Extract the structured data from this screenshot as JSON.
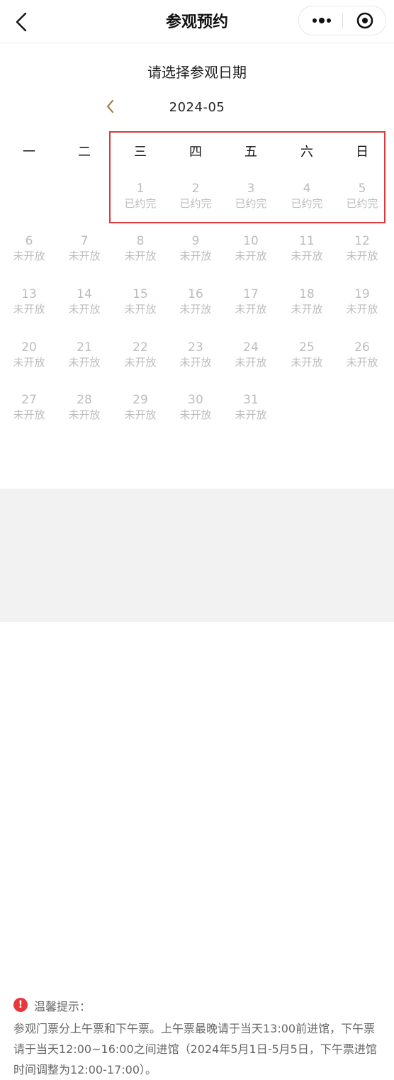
{
  "header": {
    "title": "参观预约"
  },
  "heading": "请选择参观日期",
  "month": "2024-05",
  "weekdays": [
    "一",
    "二",
    "三",
    "四",
    "五",
    "六",
    "日"
  ],
  "days": [
    {
      "num": "1",
      "status": "已约完"
    },
    {
      "num": "2",
      "status": "已约完"
    },
    {
      "num": "3",
      "status": "已约完"
    },
    {
      "num": "4",
      "status": "已约完"
    },
    {
      "num": "5",
      "status": "已约完"
    },
    {
      "num": "6",
      "status": "未开放"
    },
    {
      "num": "7",
      "status": "未开放"
    },
    {
      "num": "8",
      "status": "未开放"
    },
    {
      "num": "9",
      "status": "未开放"
    },
    {
      "num": "10",
      "status": "未开放"
    },
    {
      "num": "11",
      "status": "未开放"
    },
    {
      "num": "12",
      "status": "未开放"
    },
    {
      "num": "13",
      "status": "未开放"
    },
    {
      "num": "14",
      "status": "未开放"
    },
    {
      "num": "15",
      "status": "未开放"
    },
    {
      "num": "16",
      "status": "未开放"
    },
    {
      "num": "17",
      "status": "未开放"
    },
    {
      "num": "18",
      "status": "未开放"
    },
    {
      "num": "19",
      "status": "未开放"
    },
    {
      "num": "20",
      "status": "未开放"
    },
    {
      "num": "21",
      "status": "未开放"
    },
    {
      "num": "22",
      "status": "未开放"
    },
    {
      "num": "23",
      "status": "未开放"
    },
    {
      "num": "24",
      "status": "未开放"
    },
    {
      "num": "25",
      "status": "未开放"
    },
    {
      "num": "26",
      "status": "未开放"
    },
    {
      "num": "27",
      "status": "未开放"
    },
    {
      "num": "28",
      "status": "未开放"
    },
    {
      "num": "29",
      "status": "未开放"
    },
    {
      "num": "30",
      "status": "未开放"
    },
    {
      "num": "31",
      "status": "未开放"
    }
  ],
  "notice": {
    "icon": "!",
    "title": "温馨提示：",
    "body": "参观门票分上午票和下午票。上午票最晚请于当天13:00前进馆，下午票请于当天12:00~16:00之间进馆（2024年5月1日-5月5日，下午票进馆时间调整为12:00-17:00）。"
  },
  "colors": {
    "highlight": "#d93a3f",
    "disabled_text": "#bdbdbd",
    "accent_arrow": "#a0824a",
    "warning": "#e8363d"
  },
  "icons": [
    "back-arrow-icon",
    "more-dots-icon",
    "close-target-icon",
    "prev-month-icon",
    "warning-icon"
  ]
}
